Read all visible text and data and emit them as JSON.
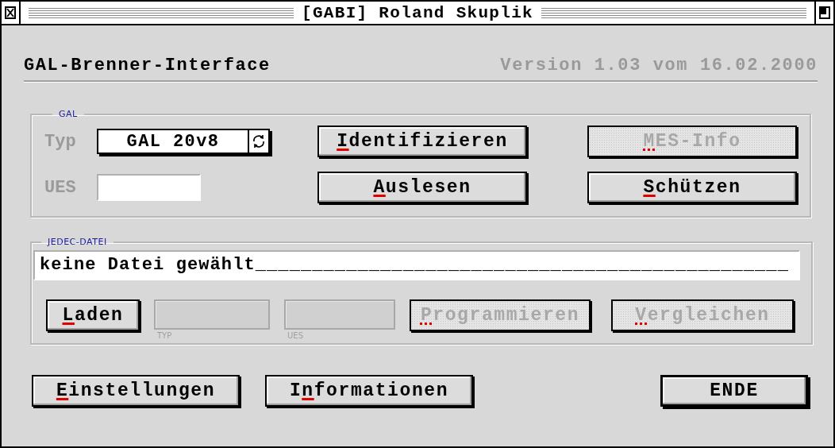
{
  "window": {
    "title": "[GABI] Roland Skuplik"
  },
  "header": {
    "title": "GAL-Brenner-Interface",
    "version": "Version 1.03 vom 16.02.2000"
  },
  "gal": {
    "caption": "GAL",
    "typ_label": "Typ",
    "typ_value": "GAL 20v8",
    "ues_label": "UES",
    "buttons": [
      {
        "key": "I",
        "post": "dentifizieren",
        "disabled": false,
        "default": false
      },
      {
        "key": "M",
        "post": "ES-Info",
        "disabled": true,
        "default": false
      },
      {
        "key": "A",
        "post": "uslesen",
        "disabled": false,
        "default": false
      },
      {
        "key": "S",
        "post": "chützen",
        "disabled": false,
        "default": false
      }
    ]
  },
  "jedec": {
    "caption": "JEDEC-DATEI",
    "file": "keine Datei gewählt_______________________________________________",
    "load": {
      "key": "L",
      "post": "aden",
      "disabled": false,
      "default": false
    },
    "fields": [
      {
        "caption": "TYP"
      },
      {
        "caption": "UES"
      }
    ],
    "buttons": [
      {
        "key": "P",
        "post": "rogrammieren",
        "disabled": true,
        "default": false
      },
      {
        "key": "V",
        "post": "ergleichen",
        "disabled": true,
        "default": false
      }
    ]
  },
  "footer": [
    {
      "key": "E",
      "post": "instellungen",
      "disabled": false,
      "default": false
    },
    {
      "pre": "I",
      "key": "n",
      "post": "formationen",
      "disabled": false,
      "default": false
    },
    {
      "label": "ENDE",
      "disabled": false,
      "default": true
    }
  ]
}
